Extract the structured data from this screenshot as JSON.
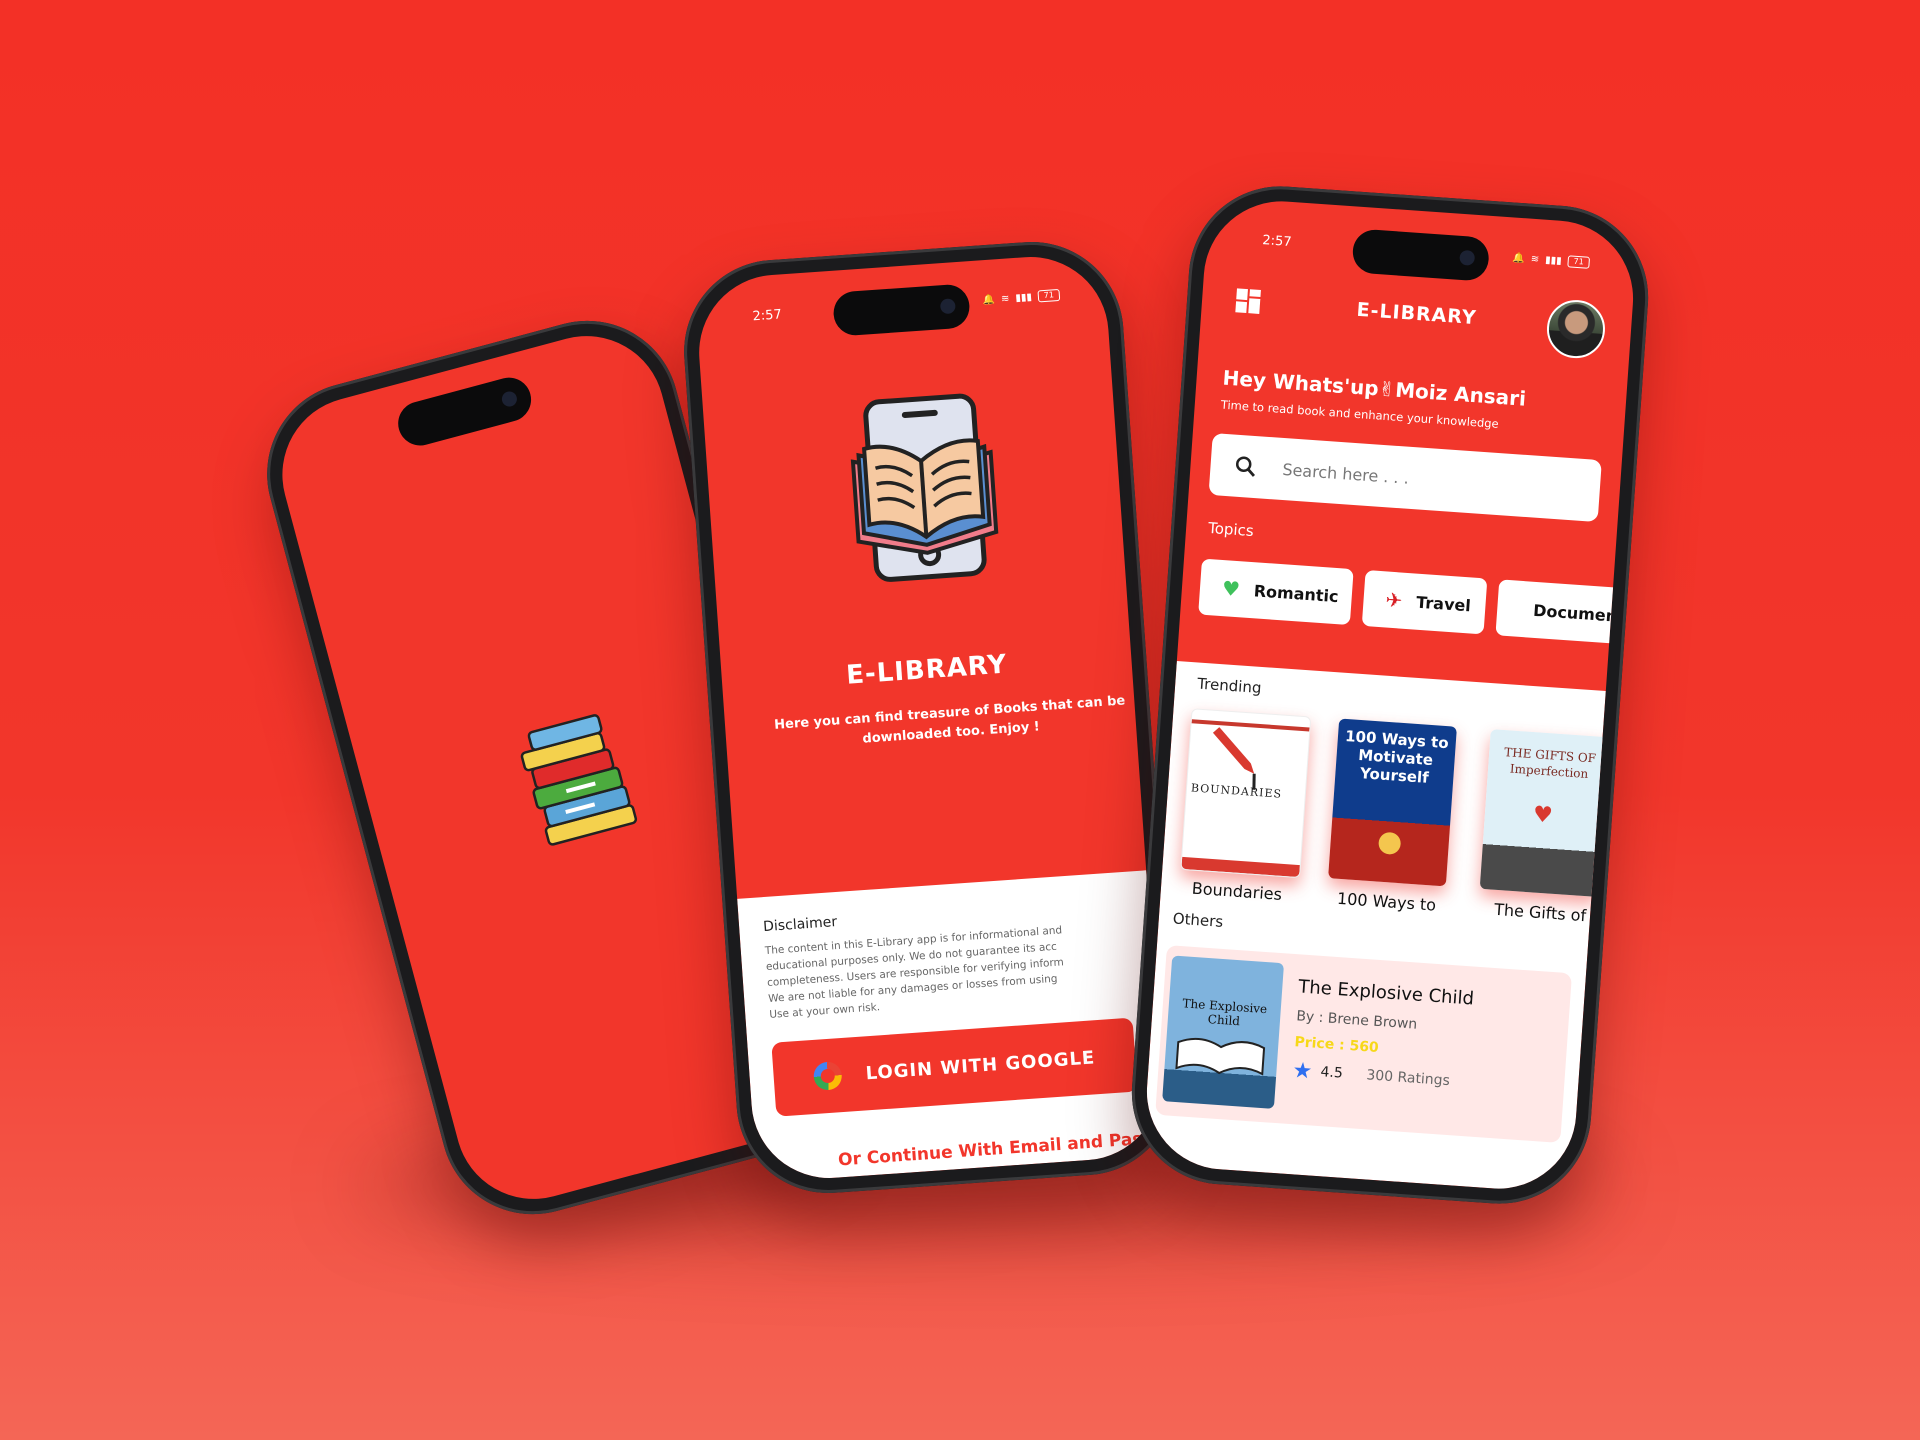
{
  "colors": {
    "brand": "#f2362b",
    "white": "#ffffff",
    "card_pink": "#ffe8e7",
    "price": "#f7d81a",
    "star": "#2f6ff0"
  },
  "status": {
    "time": "2:57",
    "battery": "71"
  },
  "login": {
    "title": "E-LIBRARY",
    "tagline_line1": "Here you can find treasure of Books that can be",
    "tagline_line2": "downloaded too. Enjoy !",
    "disclaimer_title": "Disclaimer",
    "disclaimer_lines": [
      "The content in this E-Library app is for informational and",
      "educational purposes only. We do not guarantee its acc",
      "completeness. Users are responsible for verifying inform",
      "We are not liable for any damages or losses from using",
      "Use at your own risk."
    ],
    "google_button": "LOGIN WITH GOOGLE",
    "email_link": "Or Continue With Email and Pas"
  },
  "home": {
    "title": "E-LIBRARY",
    "greeting": "Hey Whats'up✌Moiz Ansari",
    "subtitle": "Time to read book and enhance your knowledge",
    "search_placeholder": "Search here . . .",
    "topics_label": "Topics",
    "topics": [
      {
        "label": "Romantic",
        "icon": "heart-icon"
      },
      {
        "label": "Travel",
        "icon": "plane-icon"
      },
      {
        "label": "Documentar",
        "icon": "globe-icon"
      }
    ],
    "trending_label": "Trending",
    "trending": [
      {
        "title": "Boundaries",
        "cover_text": "BOUNDARIES"
      },
      {
        "title": "100 Ways to",
        "cover_text": "100 Ways to Motivate Yourself"
      },
      {
        "title": "The Gifts of",
        "cover_text": "THE GIFTS OF Imperfection"
      }
    ],
    "others_label": "Others",
    "featured": {
      "title": "The Explosive Child",
      "author": "By : Brene Brown",
      "price": "Price : 560",
      "rating": "4.5",
      "ratings_count": "300 Ratings",
      "cover_text": "The Explosive Child"
    }
  }
}
